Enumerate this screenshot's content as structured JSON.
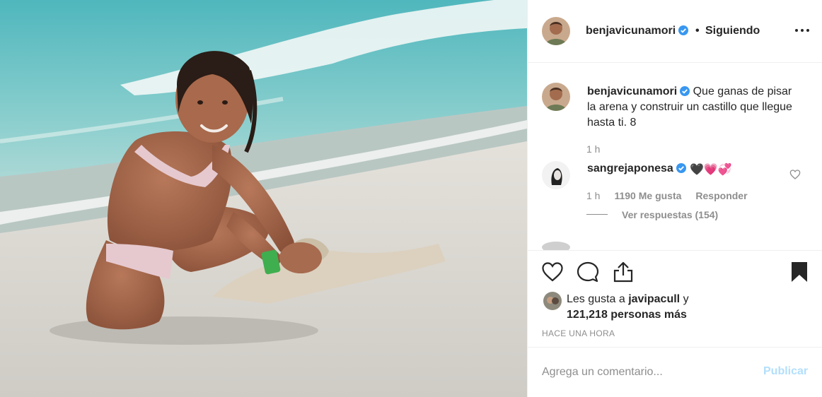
{
  "post": {
    "image_alt": "child-building-sand-castle-photo",
    "author": {
      "username": "benjavicunamori",
      "verified": true,
      "separator": "•",
      "follow_status": "Siguiendo"
    },
    "caption": {
      "username": "benjavicunamori",
      "text": "Que ganas de pisar la arena y construir un castillo que llegue hasta ti. 8",
      "time": "1 h"
    },
    "comments": [
      {
        "username": "sangrejaponesa",
        "verified": true,
        "text": "🖤💗💞",
        "time": "1 h",
        "likes": "1190 Me gusta",
        "reply_label": "Responder",
        "view_replies": "Ver respuestas (154)"
      }
    ],
    "likes": {
      "prefix": "Les gusta a",
      "user": "javipacull",
      "conjunction": "y",
      "others": "121,218 personas más"
    },
    "time_ago": "HACE UNA HORA",
    "add_comment": {
      "placeholder": "Agrega un comentario...",
      "submit_label": "Publicar"
    },
    "icons": [
      "more-options-icon",
      "verified-badge-icon",
      "heart-icon",
      "comment-icon",
      "share-icon",
      "save-bookmark-icon"
    ],
    "colors": {
      "verified": "#3897f0",
      "muted_text": "#8e8e8e",
      "publish_disabled": "#b2dffc",
      "divider": "#efefef"
    }
  }
}
